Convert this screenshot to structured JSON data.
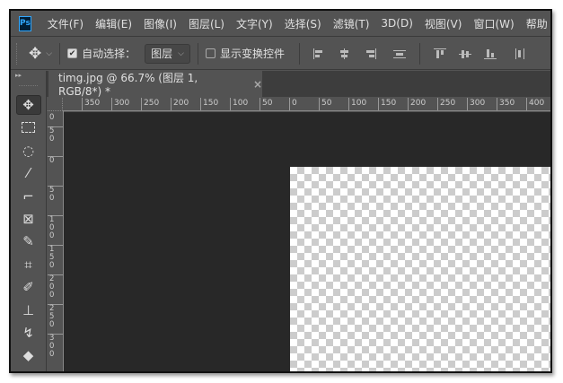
{
  "app": {
    "logo": "Ps"
  },
  "menu": [
    "文件(F)",
    "编辑(E)",
    "图像(I)",
    "图层(L)",
    "文字(Y)",
    "选择(S)",
    "滤镜(T)",
    "3D(D)",
    "视图(V)",
    "窗口(W)",
    "帮助"
  ],
  "options": {
    "auto_select_label": "自动选择：",
    "auto_select_checked": true,
    "layer_select": "图层",
    "show_transform_label": "显示变换控件",
    "show_transform_checked": false
  },
  "document_tab": {
    "title": "timg.jpg @ 66.7% (图层 1, RGB/8*) *",
    "close": "×"
  },
  "hruler": [
    "0",
    "350",
    "300",
    "250",
    "200",
    "150",
    "100",
    "50",
    "0",
    "50",
    "100",
    "150",
    "200",
    "250",
    "300",
    "350",
    "400"
  ],
  "vruler": [
    "1\n0\n0",
    "5\n0",
    "0",
    "5\n0",
    "1\n0\n0",
    "1\n5\n0",
    "2\n0\n0",
    "2\n5\n0",
    "3\n0\n0"
  ],
  "tools": [
    "move",
    "rectangular-marquee",
    "lasso",
    "quick-selection",
    "crop",
    "frame",
    "eyedropper",
    "spot-healing",
    "brush",
    "clone-stamp",
    "history-brush",
    "eraser"
  ]
}
